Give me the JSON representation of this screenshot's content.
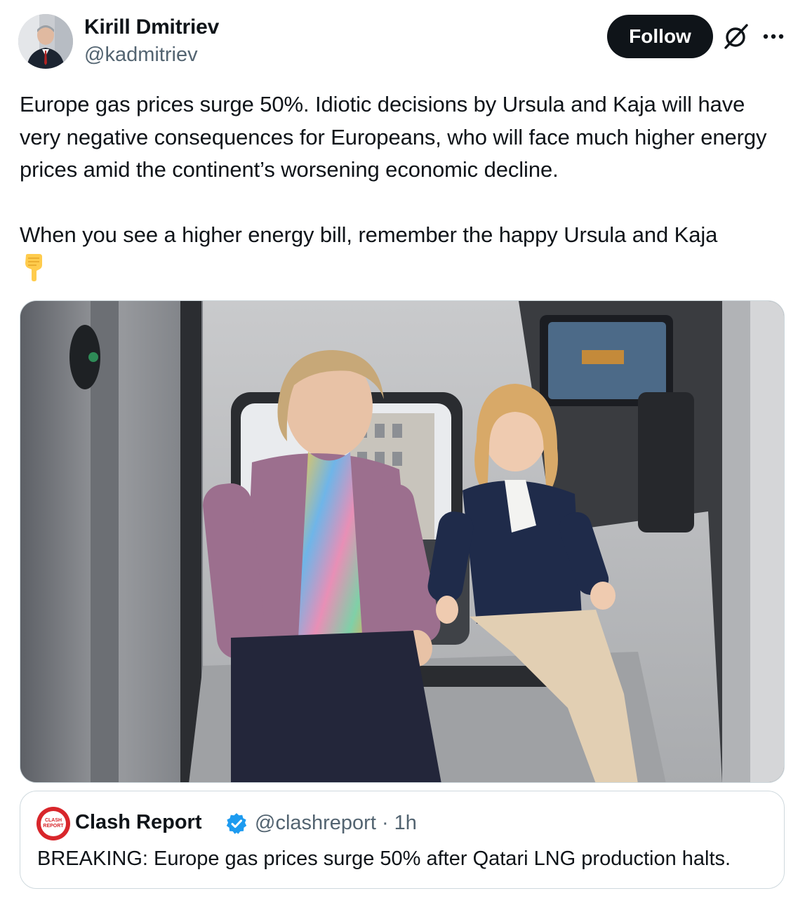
{
  "author": {
    "name": "Kirill Dmitriev",
    "handle": "@kadmitriev",
    "avatar_icon": "profile-photo"
  },
  "actions": {
    "follow_label": "Follow",
    "grok_icon": "grok-icon",
    "more_icon": "more-horizontal-icon"
  },
  "tweet": {
    "paragraph1": "Europe gas prices surge 50%. Idiotic decisions by Ursula and Kaja will have very negative consequences for Europeans, who will face much higher energy prices amid the continent’s worsening economic decline.",
    "paragraph2": "When you see a higher energy bill, remember the happy Ursula and Kaja",
    "emoji": "backhand-index-pointing-down"
  },
  "media": {
    "kind": "photo"
  },
  "quote": {
    "avatar_text": "CLASH REPORT",
    "name": "Clash Report",
    "verified": true,
    "handle_time": "@clashreport · 1h",
    "text": "BREAKING: Europe gas prices surge 50% after Qatari LNG production halts."
  },
  "colors": {
    "text_primary": "#0f1419",
    "text_secondary": "#536471",
    "follow_bg": "#0f1419",
    "verified_blue": "#1d9bf0",
    "border": "#cfd9de",
    "brand_red": "#d8262b"
  }
}
